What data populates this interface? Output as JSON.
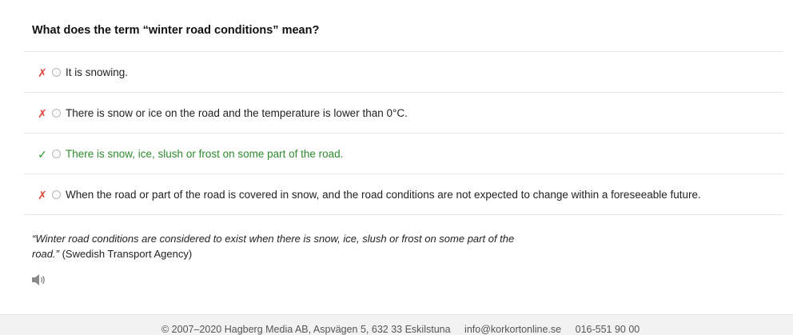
{
  "question": {
    "text": "What does the term “winter road conditions” mean?"
  },
  "answers": [
    {
      "mark": "✗",
      "status": "wrong",
      "text": "It is snowing."
    },
    {
      "mark": "✗",
      "status": "wrong",
      "text": "There is snow or ice on the road and the temperature is lower than 0°C."
    },
    {
      "mark": "✓",
      "status": "correct",
      "text": "There is snow, ice, slush or frost on some part of the road."
    },
    {
      "mark": "✗",
      "status": "wrong",
      "text": "When the road or part of the road is covered in snow, and the road conditions are not expected to change within a foreseeable future."
    }
  ],
  "explanation": {
    "quote": "“Winter road conditions are considered to exist when there is snow, ice, slush or frost on some part of the road.”",
    "source": " (Swedish Transport Agency)"
  },
  "speaker": {
    "icon": "speaker-icon"
  },
  "footer": {
    "copyright": "© 2007–2020 Hagberg Media AB, Aspvägen 5, 632 33 Eskilstuna",
    "email": "info@korkortonline.se",
    "phone": "016-551 90 00"
  },
  "colors": {
    "wrong": "#e0443a",
    "correct": "#2e9a2e",
    "footer_bg": "#f2f2f2"
  }
}
